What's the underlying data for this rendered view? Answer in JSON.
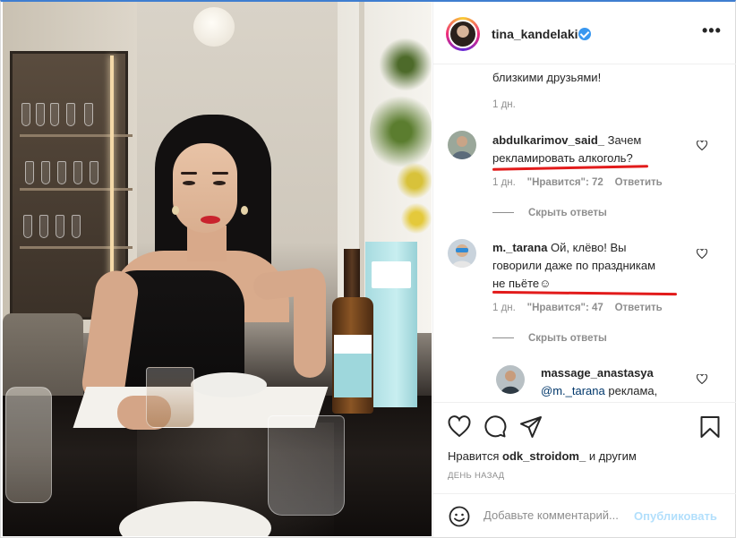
{
  "header": {
    "username": "tina_kandelaki",
    "more_label": "•••"
  },
  "comments": {
    "caption_tail": "близкими друзьями!",
    "caption_time": "1 дн.",
    "items": [
      {
        "user": "abdulkarimov_said_",
        "text_line1": "Зачем",
        "text_line2": "рекламировать алкоголь?",
        "time": "1 дн.",
        "likes": "\"Нравится\": 72",
        "reply": "Ответить",
        "replies_toggle": "Скрыть ответы"
      },
      {
        "user": "m._tarana",
        "text_line1": "Ой, клёво! Вы",
        "text_line2": "говорили даже по праздникам",
        "text_line3": "не пьёте☺",
        "time": "1 дн.",
        "likes": "\"Нравится\": 47",
        "reply": "Ответить",
        "replies_toggle": "Скрыть ответы"
      }
    ],
    "reply": {
      "user": "massage_anastasya",
      "mention": "@m._tarana",
      "text": "реклама,"
    }
  },
  "footer": {
    "likes_prefix": "Нравится",
    "likes_user": "odk_stroidom_",
    "likes_suffix": "и другим",
    "date": "ДЕНЬ НАЗАД",
    "comment_placeholder": "Добавьте комментарий...",
    "publish_label": "Опубликовать"
  },
  "icons": {
    "header": [
      "verified-badge-icon",
      "more-options-icon"
    ],
    "actions": [
      "heart-icon",
      "comment-icon",
      "share-icon",
      "bookmark-icon"
    ],
    "input": [
      "emoji-icon"
    ]
  },
  "colors": {
    "link_blue": "#3897f0",
    "publish_disabled": "#b2dffc",
    "annotation_red": "#e21b1b",
    "muted_text": "#8e8e8e"
  }
}
